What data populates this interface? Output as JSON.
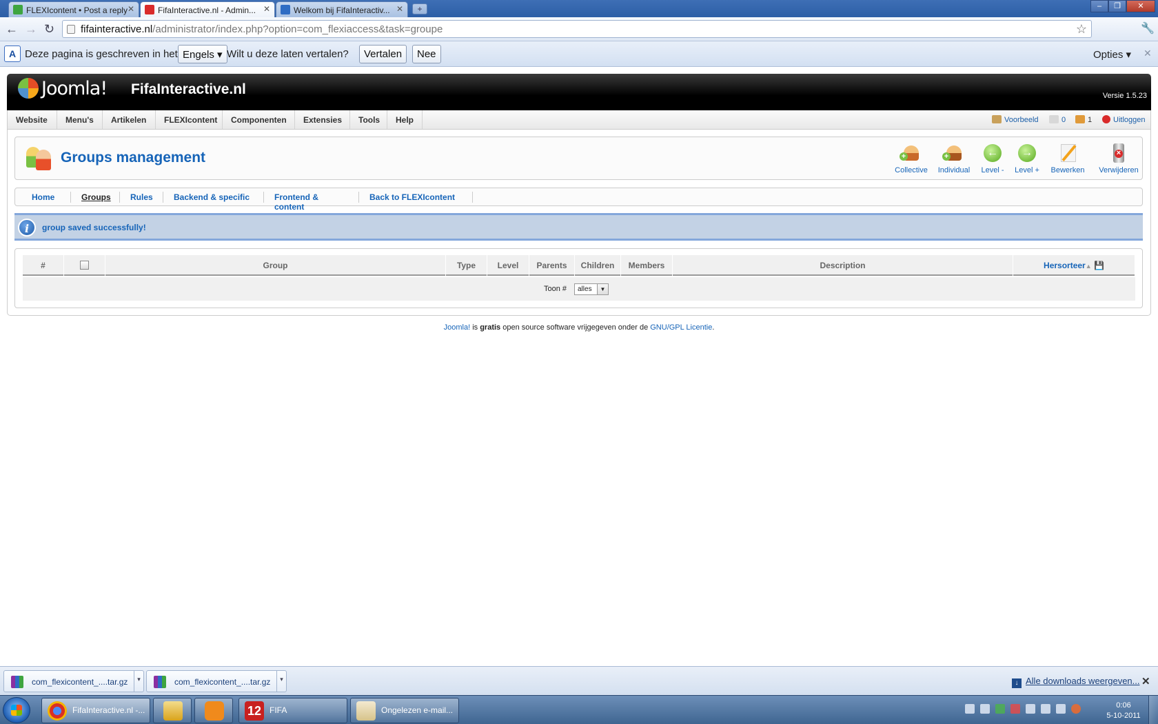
{
  "browser": {
    "tabs": [
      {
        "title": "FLEXIcontent • Post a reply",
        "favicon_color": "#3ea540"
      },
      {
        "title": "FifaInteractive.nl - Admin...",
        "favicon_color": "#d92b2b"
      },
      {
        "title": "Welkom bij FifaInteractiv...",
        "favicon_color": "#2e6cc4"
      }
    ],
    "url_host": "fifainteractive.nl",
    "url_path": "/administrator/index.php?option=com_flexiaccess&task=groupe"
  },
  "translate_bar": {
    "prefix": "Deze pagina is geschreven in het",
    "language": "Engels",
    "question": "Wilt u deze laten vertalen?",
    "translate_button": "Vertalen",
    "no_button": "Nee",
    "options": "Opties"
  },
  "joomla": {
    "logo_text": "Joomla!",
    "site_name": "FifaInteractive.nl",
    "version": "Versie 1.5.23",
    "menu": [
      "Website",
      "Menu's",
      "Artikelen",
      "FLEXIcontent",
      "Componenten",
      "Extensies",
      "Tools",
      "Help"
    ],
    "status": {
      "preview": "Voorbeeld",
      "messages": "0",
      "users": "1",
      "logout": "Uitloggen"
    }
  },
  "page": {
    "title": "Groups management",
    "toolbar": [
      {
        "label": "Collective",
        "icon": "add-group-icon"
      },
      {
        "label": "Individual",
        "icon": "add-user-icon"
      },
      {
        "label": "Level -",
        "icon": "level-down-icon"
      },
      {
        "label": "Level +",
        "icon": "level-up-icon"
      },
      {
        "label": "Bewerken",
        "icon": "edit-icon"
      },
      {
        "label": "Verwijderen",
        "icon": "delete-icon"
      }
    ],
    "submenu": [
      "Home",
      "Groups",
      "Rules",
      "Backend & specific",
      "Frontend & content",
      "Back to FLEXIcontent"
    ],
    "submenu_active": "Groups",
    "message": "group saved successfully!",
    "table": {
      "columns": [
        "#",
        "",
        "Group",
        "Type",
        "Level",
        "Parents",
        "Children",
        "Members",
        "Description",
        "Hersorteer"
      ],
      "footer_label": "Toon #",
      "display_select": "alles"
    }
  },
  "footer": {
    "joomla_link": "Joomla!",
    "text_is": " is ",
    "text_bold": "gratis",
    "text_rest": " open source software vrijgegeven onder de ",
    "license_link": "GNU/GPL Licentie",
    "end": "."
  },
  "downloads": {
    "items": [
      "com_flexicontent_....tar.gz",
      "com_flexicontent_....tar.gz"
    ],
    "show_all": "Alle downloads weergeven..."
  },
  "taskbar": {
    "tasks": [
      {
        "label": "FifaInteractive.nl -...",
        "icon_color": "#d9a31b"
      },
      {
        "label": "",
        "icon_color": "#e8c15a"
      },
      {
        "label": "",
        "icon_color": "#f08a1c"
      },
      {
        "label": "FIFA",
        "icon_color": "#c8201f"
      },
      {
        "label": "Ongelezen e-mail...",
        "icon_color": "#e8d8a0"
      }
    ],
    "time": "0:06",
    "date": "5-10-2011"
  },
  "colors": {
    "joomla_blue": "#1664b8",
    "joomla_green": "#76b729",
    "message_bg": "#c3d2e5"
  }
}
